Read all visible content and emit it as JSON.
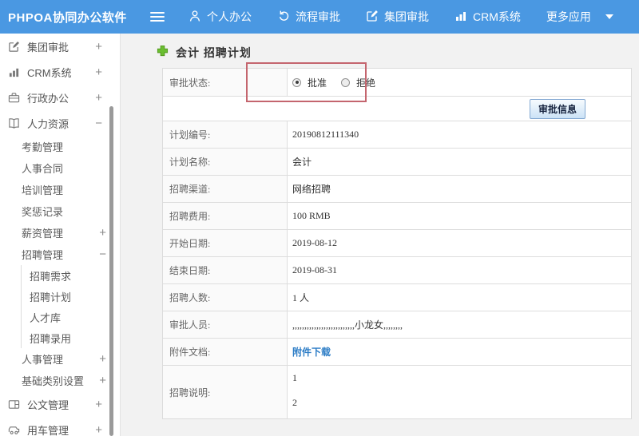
{
  "topbar": {
    "brand": "PHPOA协同办公软件",
    "items": [
      {
        "label": "个人办公",
        "icon": "user-icon"
      },
      {
        "label": "流程审批",
        "icon": "flow-icon"
      },
      {
        "label": "集团审批",
        "icon": "edit-icon"
      },
      {
        "label": "CRM系统",
        "icon": "bar-chart-icon"
      },
      {
        "label": "更多应用",
        "icon": "caret-down-icon"
      }
    ]
  },
  "sidebar": {
    "items": [
      {
        "label": "集团审批",
        "expand": "+",
        "icon": "edit-icon"
      },
      {
        "label": "CRM系统",
        "expand": "+",
        "icon": "bar-chart-icon"
      },
      {
        "label": "行政办公",
        "expand": "+",
        "icon": "briefcase-icon"
      },
      {
        "label": "人力资源",
        "expand": "−",
        "icon": "book-icon"
      },
      {
        "label": "考勤管理"
      },
      {
        "label": "人事合同"
      },
      {
        "label": "培训管理"
      },
      {
        "label": "奖惩记录"
      },
      {
        "label": "薪资管理",
        "expand": "+"
      },
      {
        "label": "招聘管理",
        "expand": "−"
      },
      {
        "label": "招聘需求"
      },
      {
        "label": "招聘计划"
      },
      {
        "label": "人才库"
      },
      {
        "label": "招聘录用"
      },
      {
        "label": "人事管理",
        "expand": "+"
      },
      {
        "label": "基础类别设置",
        "expand": "+"
      },
      {
        "label": "公文管理",
        "expand": "+",
        "icon": "document-icon"
      },
      {
        "label": "用车管理",
        "expand": "+",
        "icon": "car-icon"
      }
    ]
  },
  "main": {
    "title": "会计 招聘计划",
    "status": {
      "label": "审批状态:",
      "approve": "批准",
      "reject": "拒绝"
    },
    "info_button": "审批信息",
    "rows": [
      {
        "label": "计划编号:",
        "value": "20190812111340"
      },
      {
        "label": "计划名称:",
        "value": "会计"
      },
      {
        "label": "招聘渠道:",
        "value": "网络招聘"
      },
      {
        "label": "招聘费用:",
        "value": "100 RMB"
      },
      {
        "label": "开始日期:",
        "value": "2019-08-12"
      },
      {
        "label": "结束日期:",
        "value": "2019-08-31"
      },
      {
        "label": "招聘人数:",
        "value": "1 人"
      },
      {
        "label": "审批人员:",
        "value": ",,,,,,,,,,,,,,,,,,,,,,,,,,小龙女,,,,,,,,"
      }
    ],
    "attachment": {
      "label": "附件文档:",
      "link": "附件下载"
    },
    "description": {
      "label": "招聘说明:",
      "line1": "1",
      "line2": "2"
    }
  },
  "icons": [
    "menu-icon",
    "user-icon",
    "flow-icon",
    "edit-icon",
    "bar-chart-icon",
    "caret-down-icon",
    "briefcase-icon",
    "book-icon",
    "document-icon",
    "car-icon",
    "plus-icon"
  ],
  "colors": {
    "topbar_bg": "#4a98e2",
    "link_blue": "#2d7dc6",
    "annotation_red": "#c4656e",
    "plus_green": "#6abe30",
    "button_border": "#84a9d2"
  }
}
